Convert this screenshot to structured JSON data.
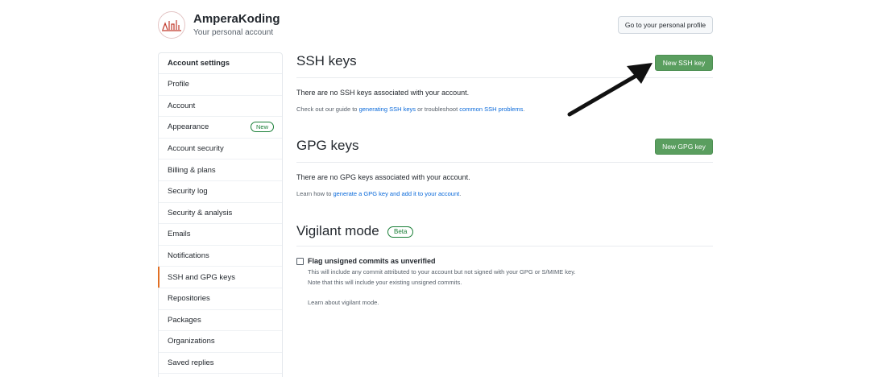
{
  "header": {
    "account_name": "AmperaKoding",
    "account_subtitle": "Your personal account",
    "profile_button_label": "Go to your personal profile"
  },
  "sidebar": {
    "heading": "Account settings",
    "items": [
      {
        "label": "Profile"
      },
      {
        "label": "Account"
      },
      {
        "label": "Appearance",
        "badge": "New"
      },
      {
        "label": "Account security"
      },
      {
        "label": "Billing & plans"
      },
      {
        "label": "Security log"
      },
      {
        "label": "Security & analysis"
      },
      {
        "label": "Emails"
      },
      {
        "label": "Notifications"
      },
      {
        "label": "SSH and GPG keys",
        "selected": true
      },
      {
        "label": "Repositories"
      },
      {
        "label": "Packages"
      },
      {
        "label": "Organizations"
      },
      {
        "label": "Saved replies"
      }
    ]
  },
  "ssh": {
    "title": "SSH keys",
    "button_label": "New SSH key",
    "empty_message": "There are no SSH keys associated with your account.",
    "hint_prefix": "Check out our guide to ",
    "hint_link1": "generating SSH keys",
    "hint_middle": " or troubleshoot ",
    "hint_link2": "common SSH problems",
    "hint_suffix": "."
  },
  "gpg": {
    "title": "GPG keys",
    "button_label": "New GPG key",
    "empty_message": "There are no GPG keys associated with your account.",
    "hint_prefix": "Learn how to ",
    "hint_link": "generate a GPG key and add it to your account",
    "hint_suffix": "."
  },
  "vigilant": {
    "title": "Vigilant mode",
    "badge": "Beta",
    "checkbox_label": "Flag unsigned commits as unverified",
    "checked": false,
    "desc_line1": "This will include any commit attributed to your account but not signed with your GPG or S/MIME key.",
    "desc_line2": "Note that this will include your existing unsigned commits.",
    "learn_link": "Learn about vigilant mode."
  },
  "colors": {
    "primary_button": "#5a9e5f",
    "link": "#0969da",
    "selected_indicator": "#e16f24",
    "badge_green": "#1a7f37"
  },
  "icons": [
    "avatar-logo",
    "arrow-annotation"
  ]
}
